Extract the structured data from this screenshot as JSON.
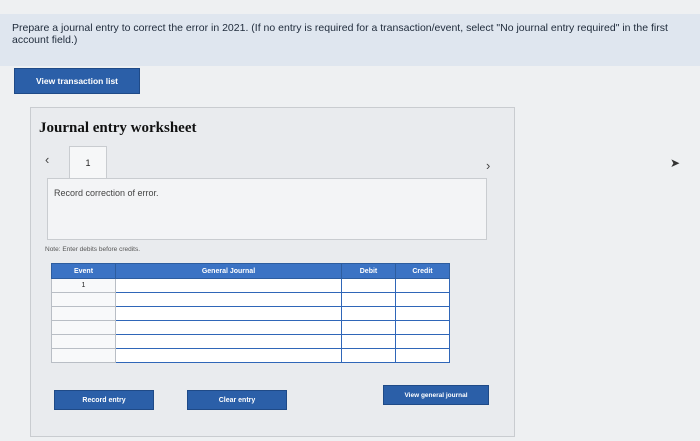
{
  "instruction": {
    "text": "Prepare a journal entry to correct the error in 2021. (If no entry is required for a transaction/event, select \"No journal entry required\" in the first account field.)"
  },
  "buttons": {
    "view_transaction_list": "View transaction list",
    "record_entry": "Record entry",
    "clear_entry": "Clear entry",
    "view_general_journal": "View general journal"
  },
  "worksheet": {
    "title": "Journal entry worksheet",
    "tab_label": "1",
    "prev_icon": "chevron-left",
    "next_icon": "chevron-right",
    "description": "Record correction of error.",
    "note": "Note: Enter debits before credits."
  },
  "table": {
    "headers": [
      "Event",
      "General Journal",
      "Debit",
      "Credit"
    ],
    "rows": [
      {
        "event": "1",
        "account": "",
        "debit": "",
        "credit": ""
      },
      {
        "event": "",
        "account": "",
        "debit": "",
        "credit": ""
      },
      {
        "event": "",
        "account": "",
        "debit": "",
        "credit": ""
      },
      {
        "event": "",
        "account": "",
        "debit": "",
        "credit": ""
      },
      {
        "event": "",
        "account": "",
        "debit": "",
        "credit": ""
      },
      {
        "event": "",
        "account": "",
        "debit": "",
        "credit": ""
      }
    ]
  },
  "colors": {
    "accent": "#2b5fa8",
    "table_header": "#3b73c4",
    "instruction_bg": "#dfe6ef"
  }
}
